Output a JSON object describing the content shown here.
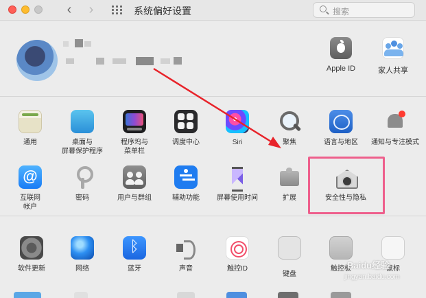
{
  "window": {
    "title": "系统偏好设置"
  },
  "search": {
    "placeholder": "搜索"
  },
  "account": {
    "items": [
      {
        "label": "Apple ID"
      },
      {
        "label": "家人共享"
      }
    ]
  },
  "grid_primary": [
    {
      "label": "通用"
    },
    {
      "label": "桌面与\n屏幕保护程序"
    },
    {
      "label": "程序坞与\n菜单栏"
    },
    {
      "label": "调度中心"
    },
    {
      "label": "Siri"
    },
    {
      "label": "聚焦"
    },
    {
      "label": "语言与地区"
    },
    {
      "label": "通知与专注模式"
    },
    {
      "label": "互联网\n帐户"
    },
    {
      "label": "密码"
    },
    {
      "label": "用户与群组"
    },
    {
      "label": "辅助功能"
    },
    {
      "label": "屏幕使用时间"
    },
    {
      "label": "扩展"
    },
    {
      "label": "安全性与隐私"
    }
  ],
  "grid_hardware": [
    {
      "label": "软件更新"
    },
    {
      "label": "网络"
    },
    {
      "label": "蓝牙"
    },
    {
      "label": "声音"
    },
    {
      "label": "触控ID"
    },
    {
      "label": "键盘"
    },
    {
      "label": "触控板"
    },
    {
      "label": "鼠标"
    }
  ],
  "watermark": {
    "line1": "Baidu经验",
    "line2": "jingyan.baidu.com"
  },
  "colors": {
    "highlight": "#ee5f8c",
    "arrow": "#e8232a"
  }
}
